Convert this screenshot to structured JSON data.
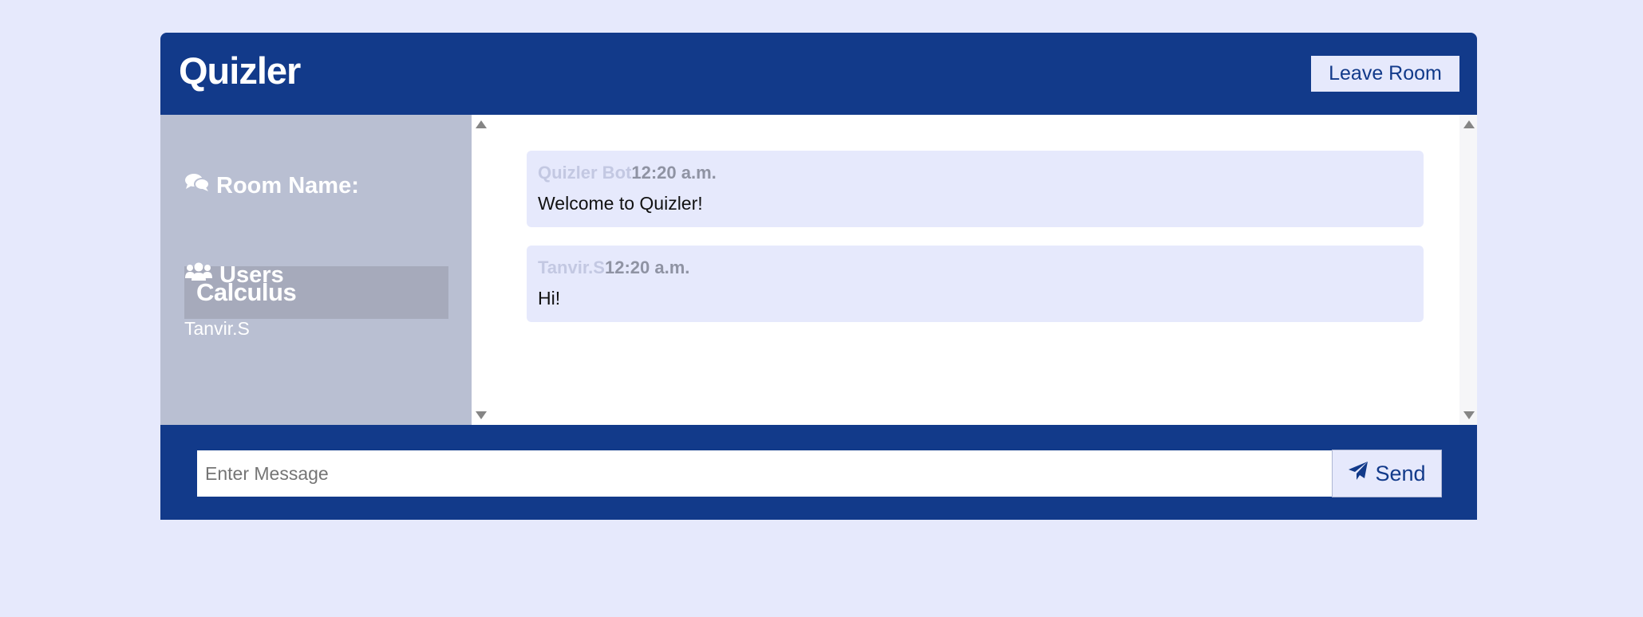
{
  "header": {
    "brand": "Quizler",
    "leave_label": "Leave Room"
  },
  "sidebar": {
    "room_heading": "Room Name:",
    "room_name": "Calculus",
    "users_heading": "Users",
    "users": [
      "Tanvir.S"
    ]
  },
  "messages": [
    {
      "author": "Quizler Bot",
      "time": "12:20 a.m.",
      "text": "Welcome to Quizler!"
    },
    {
      "author": "Tanvir.S",
      "time": "12:20 a.m.",
      "text": "Hi!"
    }
  ],
  "composer": {
    "placeholder": "Enter Message",
    "send_label": "Send"
  },
  "icons": {
    "room": "comments-icon",
    "users": "users-icon",
    "send": "paper-plane-icon"
  },
  "colors": {
    "primary": "#123a8a",
    "background": "#e6e9fc",
    "sidebar": "#b9bfd2",
    "room_box": "#a6aabb",
    "message_bg": "#e6e9fc"
  }
}
